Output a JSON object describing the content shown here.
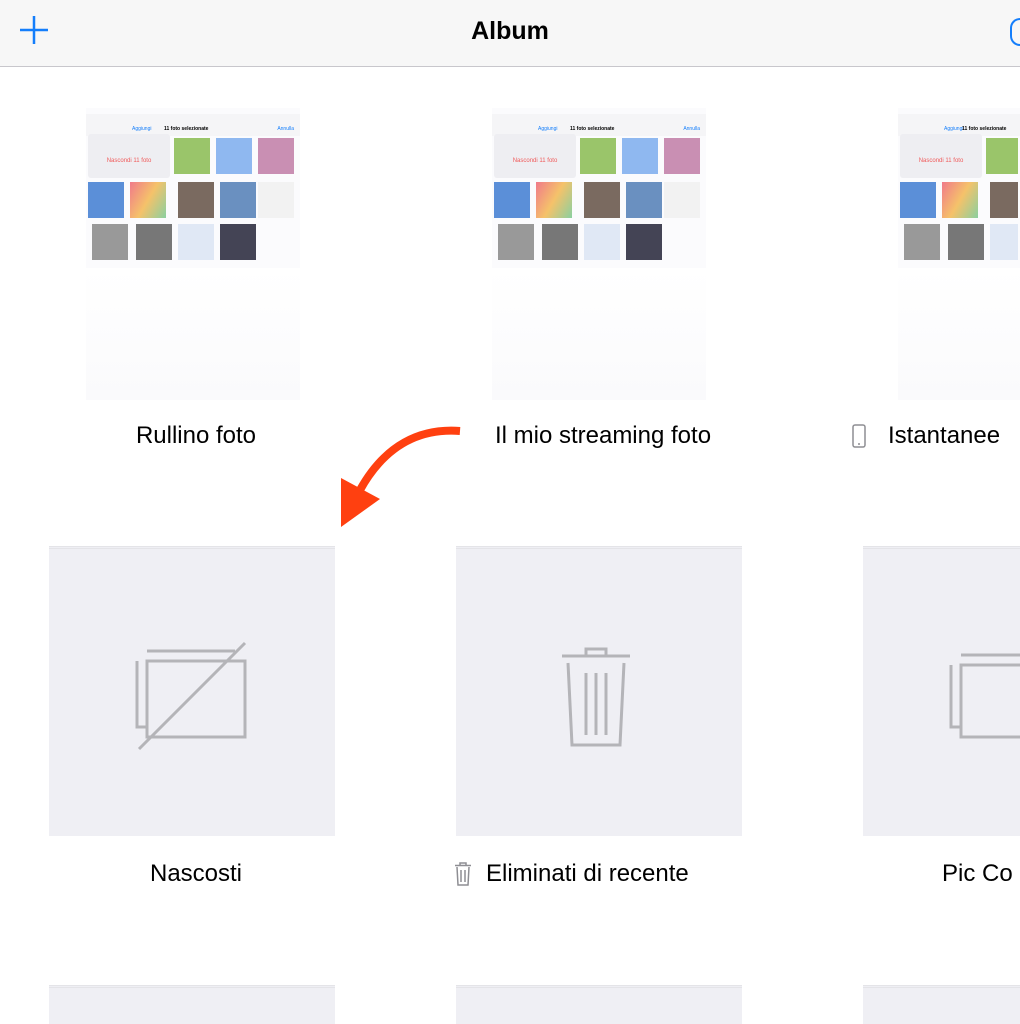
{
  "nav": {
    "title": "Album",
    "add_icon": "plus-icon",
    "search_icon": "search-icon",
    "accent": "#147efb"
  },
  "thumb_text": {
    "add": "Aggiungi",
    "title": "11 foto selezionate",
    "cancel": "Annulla",
    "hide": "Nascondi 11 foto"
  },
  "albums": [
    {
      "label": "Rullino foto"
    },
    {
      "label": "Il mio streaming foto"
    },
    {
      "label": "Istantanee",
      "icon": "phone-icon"
    },
    {
      "label": "Nascosti",
      "icon": "hidden-photos-icon"
    },
    {
      "label": "Eliminati di recente",
      "icon": "trash-icon"
    },
    {
      "label": "Pic Co"
    }
  ],
  "annotation": {
    "arrow_color": "#ff4010"
  }
}
